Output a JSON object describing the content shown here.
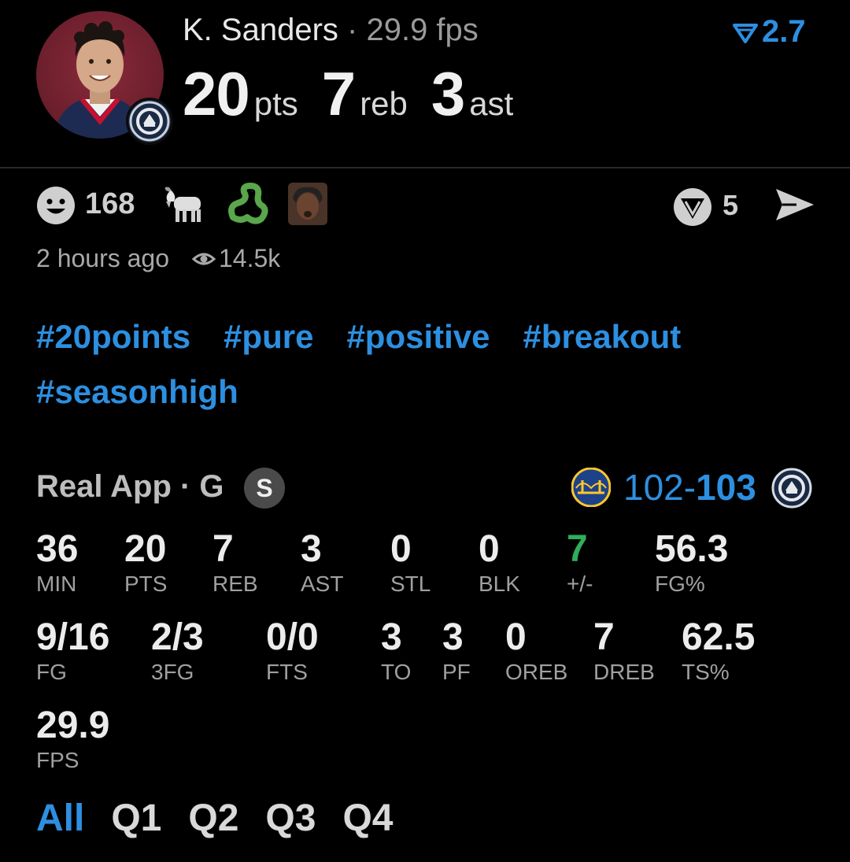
{
  "header": {
    "player_name": "K. Sanders",
    "separator": "·",
    "fantasy_points": "29.9 fps",
    "pts_value": "20",
    "pts_label": "pts",
    "reb_value": "7",
    "reb_label": "reb",
    "ast_value": "3",
    "ast_label": "ast",
    "rank_delta": "2.7",
    "rank_icon": "down-triangle-icon"
  },
  "reactions": {
    "smiley_count": "168",
    "icons": [
      "smiley-icon",
      "goat-emoji",
      "snake-emoji",
      "reaction-face-image"
    ],
    "vote_count": "5"
  },
  "meta": {
    "time": "2 hours ago",
    "views": "14.5k"
  },
  "hashtags": [
    "#20points",
    "#pure",
    "#positive",
    "#breakout",
    "#seasonhigh"
  ],
  "game": {
    "source": "Real App · G",
    "badge": "S",
    "score_home": "102-",
    "score_away": "103"
  },
  "box_row1": [
    {
      "v": "36",
      "l": "MIN"
    },
    {
      "v": "20",
      "l": "PTS"
    },
    {
      "v": "7",
      "l": "REB"
    },
    {
      "v": "3",
      "l": "AST"
    },
    {
      "v": "0",
      "l": "STL"
    },
    {
      "v": "0",
      "l": "BLK"
    },
    {
      "v": "7",
      "l": "+/-"
    },
    {
      "v": "56.3",
      "l": "FG%"
    }
  ],
  "box_row2": [
    {
      "v": "9/16",
      "l": "FG"
    },
    {
      "v": "2/3",
      "l": "3FG"
    },
    {
      "v": "0/0",
      "l": "FTS"
    },
    {
      "v": "3",
      "l": "TO"
    },
    {
      "v": "3",
      "l": "PF"
    },
    {
      "v": "0",
      "l": "OREB"
    },
    {
      "v": "7",
      "l": "DREB"
    },
    {
      "v": "62.5",
      "l": "TS%"
    }
  ],
  "box_row3": [
    {
      "v": "29.9",
      "l": "FPS"
    }
  ],
  "colors": {
    "accent": "#2d8fe0",
    "positive": "#2fae5c",
    "background": "#000000"
  },
  "quarter_tabs": [
    "All",
    "Q1",
    "Q2",
    "Q3",
    "Q4"
  ],
  "active_tab": "All"
}
